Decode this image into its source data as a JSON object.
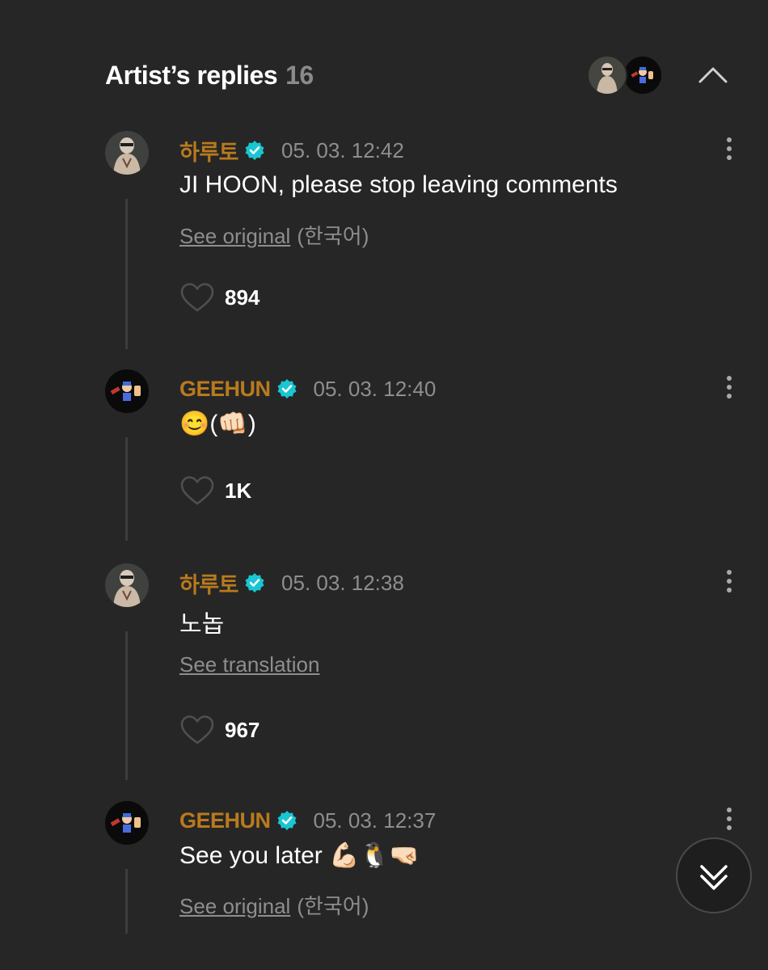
{
  "header": {
    "title": "Artist’s replies",
    "count": "16"
  },
  "comments": [
    {
      "author": "하루토",
      "timestamp": "05. 03. 12:42",
      "text": "JI HOON, please stop leaving comments",
      "see_link": "See original",
      "language": "(한국어)",
      "likes": "894",
      "avatar": "haruto-avatar"
    },
    {
      "author": "GEEHUN",
      "timestamp": "05. 03. 12:40",
      "text": "😊(👊🏻)",
      "likes": "1K",
      "avatar": "geehun-avatar"
    },
    {
      "author": "하루토",
      "timestamp": "05. 03. 12:38",
      "text": "노놉",
      "see_link": "See translation",
      "likes": "967",
      "avatar": "haruto-avatar"
    },
    {
      "author": "GEEHUN",
      "timestamp": "05. 03. 12:37",
      "text": "See you later 💪🏻🐧🤜🏻",
      "see_link": "See original",
      "language": "(한국어)",
      "avatar": "geehun-avatar"
    }
  ],
  "colors": {
    "background": "#262626",
    "author": "#b97a1d",
    "verified": "#19c6d1",
    "muted": "#8e8e8e",
    "thread_line": "#3d3d3d"
  },
  "icons": [
    "verified-badge-icon",
    "more-vertical-icon",
    "heart-icon",
    "chevron-up-icon",
    "double-chevron-down-icon"
  ]
}
